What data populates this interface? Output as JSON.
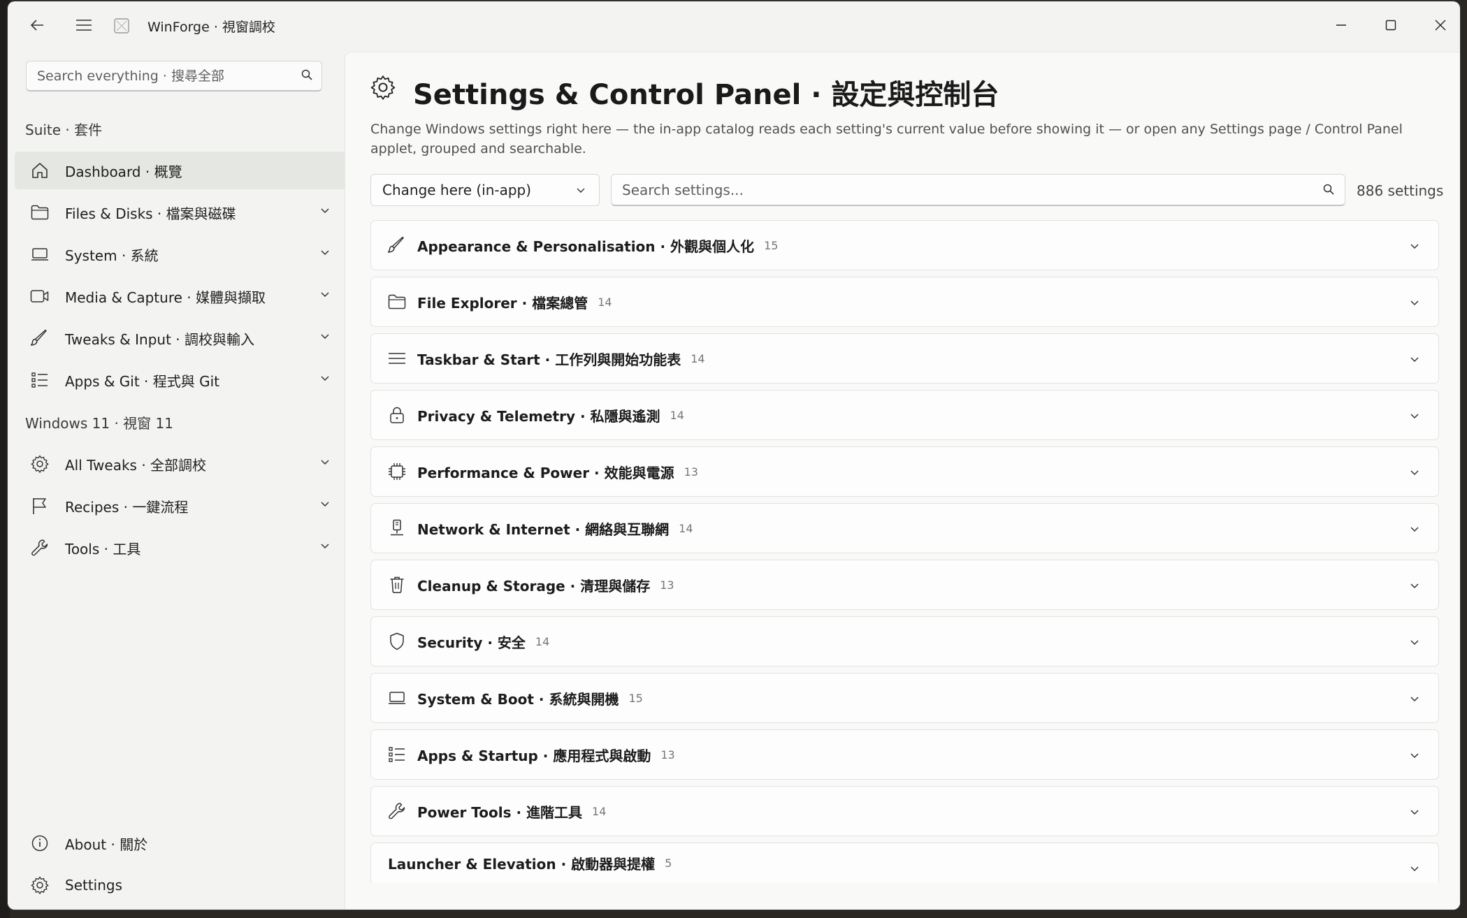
{
  "titlebar": {
    "app_title": "WinForge · 視窗調校"
  },
  "sidebar": {
    "search_placeholder": "Search everything · 搜尋全部",
    "section_suite": "Suite · 套件",
    "section_windows": "Windows 11 · 視窗 11",
    "items": [
      {
        "label": "Dashboard · 概覽",
        "icon": "home-icon",
        "active": true
      },
      {
        "label": "Files & Disks · 檔案與磁碟",
        "icon": "folder-icon"
      },
      {
        "label": "System · 系統",
        "icon": "laptop-icon"
      },
      {
        "label": "Media & Capture · 媒體與擷取",
        "icon": "video-icon"
      },
      {
        "label": "Tweaks & Input · 調校與輸入",
        "icon": "brush-icon"
      },
      {
        "label": "Apps & Git · 程式與 Git",
        "icon": "list-icon"
      },
      {
        "label": "All Tweaks · 全部調校",
        "icon": "gear-icon"
      },
      {
        "label": "Recipes · 一鍵流程",
        "icon": "flag-icon"
      },
      {
        "label": "Tools · 工具",
        "icon": "wrench-icon"
      }
    ],
    "footer": [
      {
        "label": "About · 關於",
        "icon": "info-icon"
      },
      {
        "label": "Settings",
        "icon": "gear-icon"
      }
    ]
  },
  "main": {
    "title": "Settings & Control Panel · 設定與控制台",
    "description": "Change Windows settings right here — the in-app catalog reads each setting's current value before showing it — or open any Settings page / Control Panel applet, grouped and searchable.",
    "mode_dropdown": "Change here (in-app)",
    "search_placeholder": "Search settings...",
    "count_label": "886 settings",
    "categories": [
      {
        "label": "Appearance & Personalisation · 外觀與個人化",
        "count": "15",
        "icon": "brush-icon"
      },
      {
        "label": "File Explorer · 檔案總管",
        "count": "14",
        "icon": "folder-icon"
      },
      {
        "label": "Taskbar & Start · 工作列與開始功能表",
        "count": "14",
        "icon": "menu-icon"
      },
      {
        "label": "Privacy & Telemetry · 私隱與遙測",
        "count": "14",
        "icon": "lock-icon"
      },
      {
        "label": "Performance & Power · 效能與電源",
        "count": "13",
        "icon": "chip-icon"
      },
      {
        "label": "Network & Internet · 網絡與互聯網",
        "count": "14",
        "icon": "network-icon"
      },
      {
        "label": "Cleanup & Storage · 清理與儲存",
        "count": "13",
        "icon": "trash-icon"
      },
      {
        "label": "Security · 安全",
        "count": "14",
        "icon": "shield-icon"
      },
      {
        "label": "System & Boot · 系統與開機",
        "count": "15",
        "icon": "laptop-icon"
      },
      {
        "label": "Apps & Startup · 應用程式與啟動",
        "count": "13",
        "icon": "list-icon"
      },
      {
        "label": "Power Tools · 進階工具",
        "count": "14",
        "icon": "wrench-icon"
      },
      {
        "label": "Launcher & Elevation · 啟動器與提權",
        "count": "5",
        "icon": ""
      }
    ]
  }
}
